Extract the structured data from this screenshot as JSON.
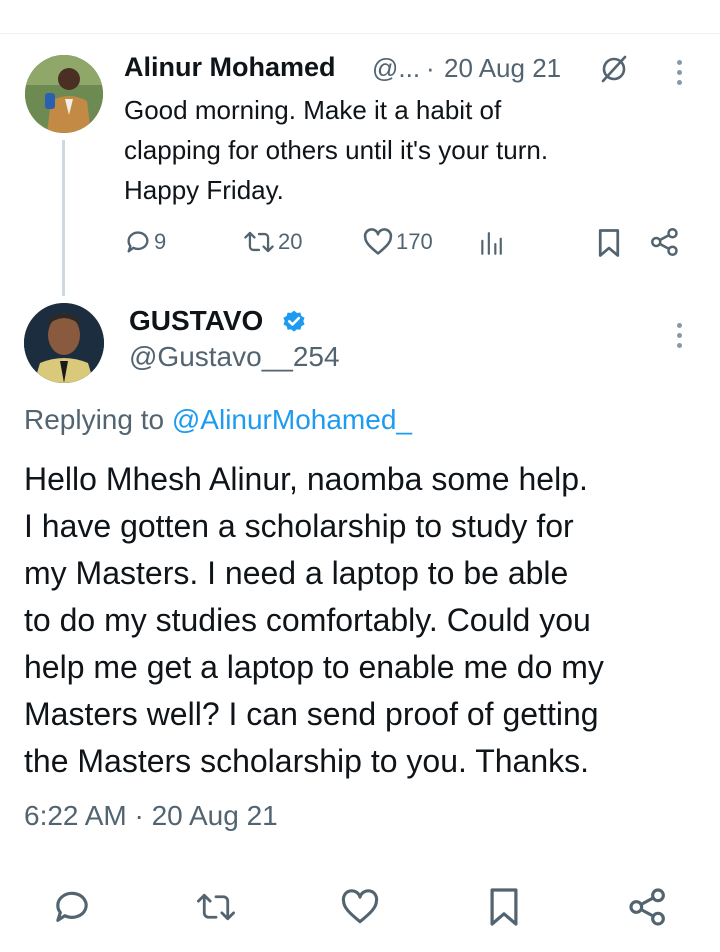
{
  "parent_tweet": {
    "author_name": "Alinur Mohamed",
    "handle_truncated": "@...",
    "separator": "·",
    "date": "20 Aug 21",
    "text": "Good morning. Make it a habit of\nclapping for others until it's your turn.\nHappy Friday.",
    "replies": "9",
    "retweets": "20",
    "likes": "170"
  },
  "reply_tweet": {
    "author_name": "GUSTAVO",
    "handle": "@Gustavo__254",
    "replying_to_label": "Replying to",
    "replying_to_handle": "@AlinurMohamed_",
    "text": "Hello Mhesh Alinur, naomba some help.\nI have gotten a scholarship to study for\nmy Masters. I need a laptop to be able\nto do my studies comfortably. Could you\nhelp me get a laptop to enable me do my\nMasters well? I can send proof of getting\nthe Masters scholarship to you. Thanks.",
    "timestamp": "6:22 AM · 20 Aug 21"
  },
  "colors": {
    "text": "#0f1419",
    "muted": "#536471",
    "link": "#1d9bf0",
    "verified": "#1d9bf0",
    "thread_line": "#cfd9de"
  },
  "icons": {
    "edited": "edited-slash-circle-icon",
    "more": "more-vertical-icon",
    "reply": "reply-bubble-icon",
    "retweet": "retweet-icon",
    "like": "heart-icon",
    "views": "bar-chart-icon",
    "bookmark": "bookmark-icon",
    "share": "share-nodes-icon",
    "verified": "verified-badge-icon"
  }
}
